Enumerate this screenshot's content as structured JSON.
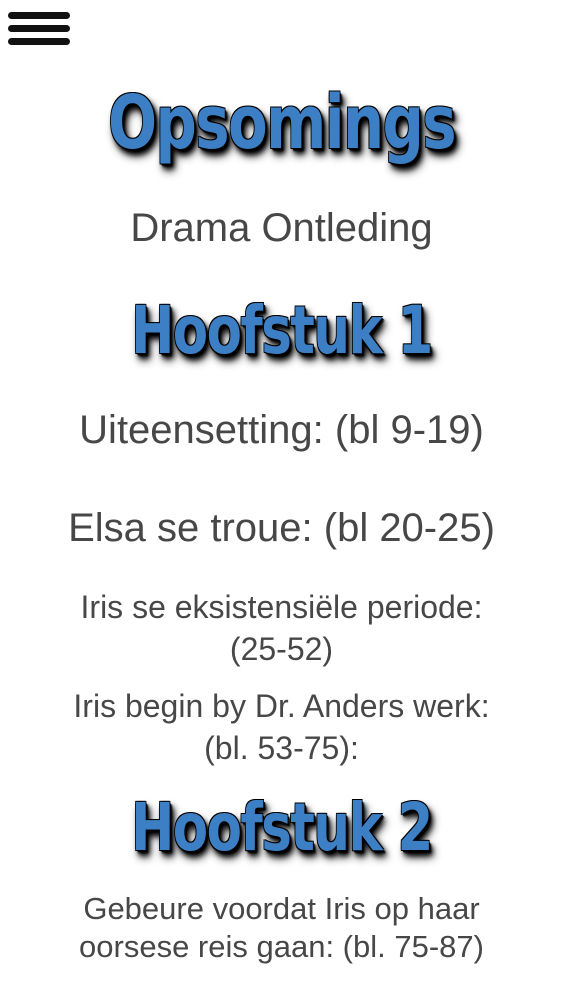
{
  "header": {
    "menu_icon": "hamburger-menu-icon"
  },
  "title": "Opsomings",
  "subtitle": "Drama Ontleding",
  "chapter1": {
    "heading": "Hoofstuk 1",
    "items": [
      {
        "line1": "Uiteensetting:  (bl 9-19)"
      },
      {
        "line1": "Elsa se troue: (bl 20-25)"
      },
      {
        "line1": "Iris se eksistensiële periode:",
        "line2": "(25-52)"
      },
      {
        "line1": "Iris begin by Dr. Anders werk:",
        "line2": "(bl. 53-75):"
      }
    ]
  },
  "chapter2": {
    "heading": "Hoofstuk 2",
    "items": [
      {
        "line1": "Gebeure voordat Iris op haar",
        "line2": "oorsese reis gaan: (bl. 75-87)"
      }
    ]
  },
  "colors": {
    "heading_fill": "#3d7fc4",
    "heading_shadow": "#000000",
    "text": "#474747",
    "background": "#ffffff"
  }
}
